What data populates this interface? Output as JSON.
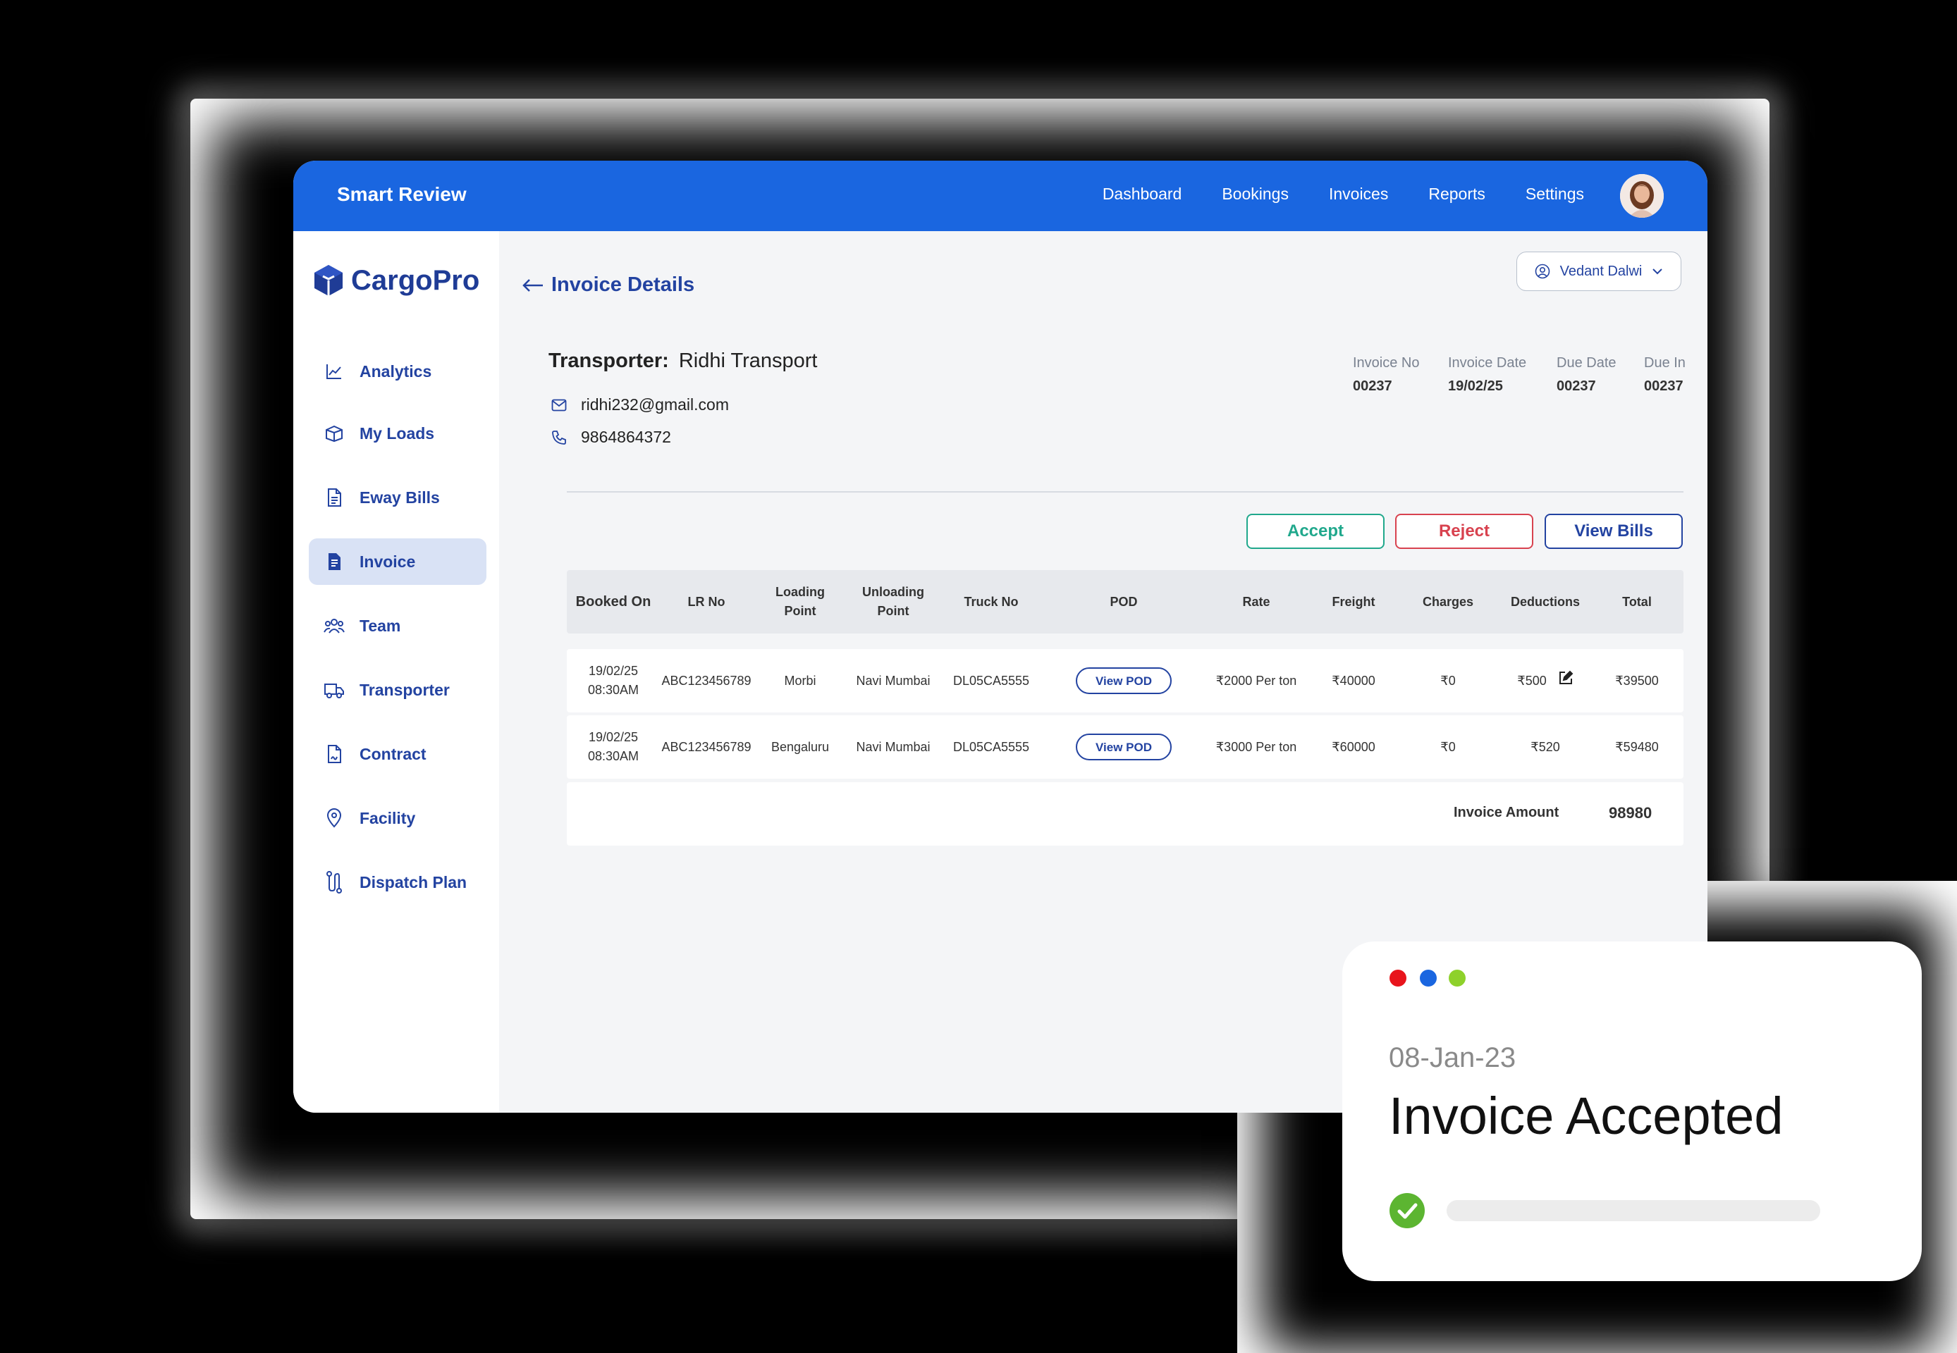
{
  "app": {
    "brand": "Smart Review",
    "top_nav": [
      "Dashboard",
      "Bookings",
      "Invoices",
      "Reports",
      "Settings"
    ]
  },
  "sidebar": {
    "logo_text": "CargoPro",
    "items": [
      {
        "label": "Analytics",
        "icon": "chart-line-icon"
      },
      {
        "label": "My Loads",
        "icon": "box-icon"
      },
      {
        "label": "Eway Bills",
        "icon": "document-icon"
      },
      {
        "label": "Invoice",
        "icon": "invoice-icon",
        "active": true
      },
      {
        "label": "Team",
        "icon": "team-icon"
      },
      {
        "label": "Transporter",
        "icon": "truck-icon"
      },
      {
        "label": "Contract",
        "icon": "contract-icon"
      },
      {
        "label": "Facility",
        "icon": "location-pin-icon"
      },
      {
        "label": "Dispatch Plan",
        "icon": "route-icon"
      }
    ]
  },
  "page": {
    "title": "Invoice Details",
    "user_name": "Vedant Dalwi",
    "transporter_label": "Transporter:",
    "transporter_name": "Ridhi Transport",
    "email": "ridhi232@gmail.com",
    "phone": "9864864372",
    "meta": [
      {
        "label": "Invoice No",
        "value": "00237"
      },
      {
        "label": "Invoice Date",
        "value": "19/02/25"
      },
      {
        "label": "Due Date",
        "value": "00237"
      },
      {
        "label": "Due In",
        "value": "00237"
      }
    ],
    "buttons": {
      "accept": "Accept",
      "reject": "Reject",
      "view_bills": "View Bills"
    }
  },
  "table": {
    "headers": [
      "Booked On",
      "LR No",
      "Loading Point",
      "Unloading Point",
      "Truck No",
      "POD",
      "Rate",
      "Freight",
      "Charges",
      "Deductions",
      "Total"
    ],
    "rows": [
      {
        "booked_on": "19/02/25 08:30AM",
        "lr_no": "ABC123456789",
        "loading": "Morbi",
        "unloading": "Navi Mumbai",
        "truck": "DL05CA5555",
        "pod": "View POD",
        "rate": "₹2000 Per ton",
        "freight": "₹40000",
        "charges": "₹0",
        "deductions": "₹500",
        "total": "₹39500"
      },
      {
        "booked_on": "19/02/25 08:30AM",
        "lr_no": "ABC123456789",
        "loading": "Bengaluru",
        "unloading": "Navi Mumbai",
        "truck": "DL05CA5555",
        "pod": "View POD",
        "rate": "₹3000 Per ton",
        "freight": "₹60000",
        "charges": "₹0",
        "deductions": "₹520",
        "total": "₹59480"
      }
    ],
    "invoice_amount_label": "Invoice Amount",
    "invoice_amount": "98980"
  },
  "notification": {
    "date": "08-Jan-23",
    "title": "Invoice Accepted",
    "dot_colors": [
      "#e8141c",
      "#1a66e0",
      "#8ed12b"
    ],
    "check_color": "#5cb531"
  }
}
